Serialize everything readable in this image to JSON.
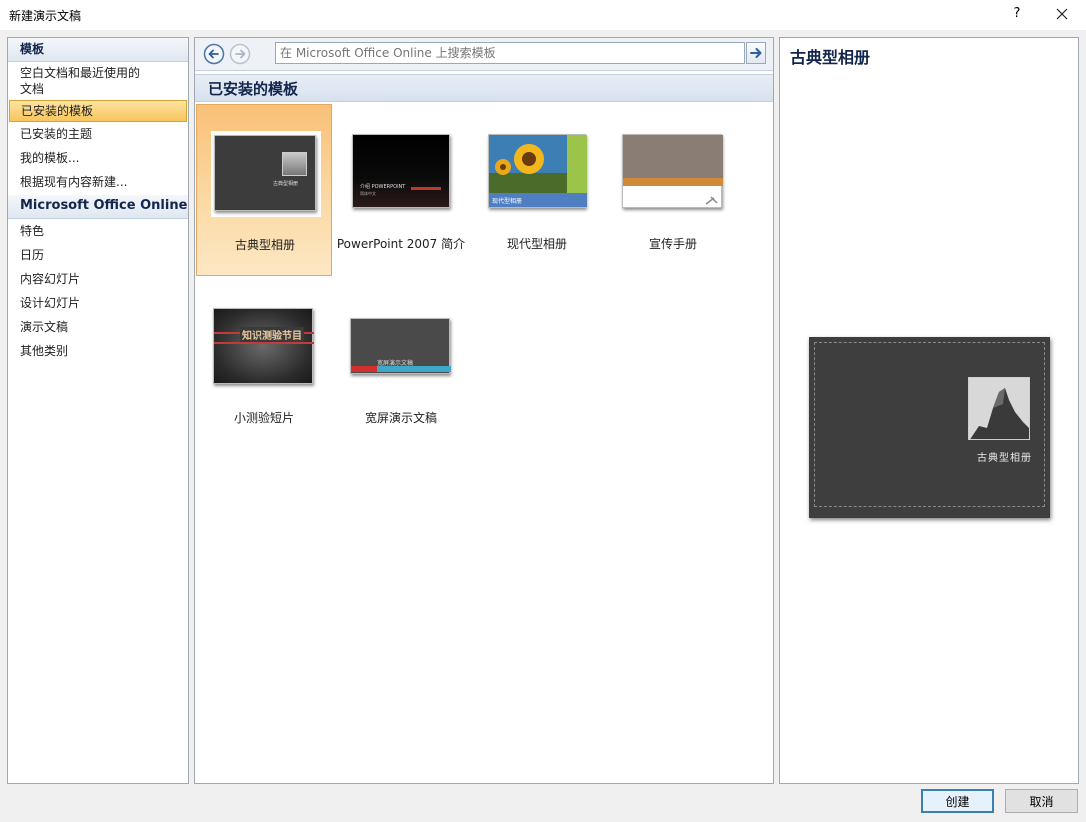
{
  "window": {
    "title": "新建演示文稿",
    "help_label": "?"
  },
  "left_nav": {
    "templates_header": "模板",
    "installed_items": [
      {
        "label": "空白文档和最近使用的文档"
      },
      {
        "label": "已安装的模板"
      },
      {
        "label": "已安装的主题"
      },
      {
        "label": "我的模板..."
      },
      {
        "label": "根据现有内容新建..."
      }
    ],
    "online_header": "Microsoft Office Online",
    "online_items": [
      {
        "label": "特色"
      },
      {
        "label": "日历"
      },
      {
        "label": "内容幻灯片"
      },
      {
        "label": "设计幻灯片"
      },
      {
        "label": "演示文稿"
      },
      {
        "label": "其他类别"
      }
    ],
    "selected": "已安装的模板"
  },
  "toolbar": {
    "search_placeholder": "在 Microsoft Office Online 上搜索模板"
  },
  "main": {
    "section_title": "已安装的模板",
    "templates": [
      {
        "label": "古典型相册",
        "selected": true,
        "thumb_text": "古典型相册"
      },
      {
        "label": "PowerPoint 2007 简介",
        "thumb_text": "介绍 POWERPOINT",
        "thumb_subtext": "简体中文"
      },
      {
        "label": "现代型相册",
        "thumb_text": "现代型相册"
      },
      {
        "label": "宣传手册"
      },
      {
        "label": "小测验短片",
        "thumb_text": "知识测验节目"
      },
      {
        "label": "宽屏演示文稿",
        "thumb_text": "宽屏演示文稿"
      }
    ]
  },
  "preview": {
    "title": "古典型相册",
    "slide_caption": "古典型相册"
  },
  "buttons": {
    "create": "创建",
    "cancel": "取消"
  },
  "colors": {
    "selection_orange": "#f9c55c",
    "header_navy": "#13254d",
    "slide_dark": "#3e3e3e",
    "accent_blue": "#3c7fb1"
  }
}
